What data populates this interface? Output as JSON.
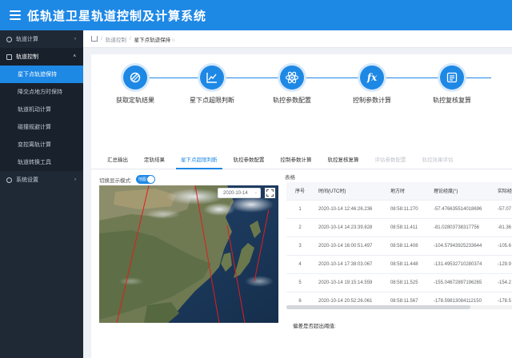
{
  "header": {
    "title": "低轨道卫星轨道控制及计算系统"
  },
  "sidebar": {
    "groups": [
      {
        "label": "轨道计算",
        "arrow": "›"
      },
      {
        "label": "轨道控制",
        "arrow": "˄"
      },
      {
        "label": "系统设置",
        "arrow": "›"
      }
    ],
    "subitems": [
      {
        "label": "星下点轨迹保持"
      },
      {
        "label": "降交点地方时保持"
      },
      {
        "label": "轨道机动计算"
      },
      {
        "label": "碰撞规避计算"
      },
      {
        "label": "变控离轨计算"
      },
      {
        "label": "轨道转换工具"
      }
    ]
  },
  "breadcrumb": {
    "parent": "轨道控制",
    "separator": "/",
    "current": "星下点轨迹保持 ◌"
  },
  "steps": [
    {
      "label": "获取定轨结果",
      "icon": "satellite-icon"
    },
    {
      "label": "星下点超限判断",
      "icon": "chart-icon"
    },
    {
      "label": "轨控参数配置",
      "icon": "atom-icon"
    },
    {
      "label": "控制参数计算",
      "icon": "fx-icon"
    },
    {
      "label": "轨控复核复算",
      "icon": "list-icon",
      "glyph": "fx"
    }
  ],
  "tabs": [
    {
      "label": "汇总输出",
      "state": "normal"
    },
    {
      "label": "定轨结果",
      "state": "normal"
    },
    {
      "label": "星下点超限判断",
      "state": "active"
    },
    {
      "label": "轨控参数配置",
      "state": "normal"
    },
    {
      "label": "控制参数计算",
      "state": "normal"
    },
    {
      "label": "轨控复核复算",
      "state": "normal"
    },
    {
      "label": "评估参数配置",
      "state": "disabled"
    },
    {
      "label": "轨控效果评估",
      "state": "disabled"
    }
  ],
  "toggle": {
    "label": "切换显示模式:",
    "value": "地图"
  },
  "map": {
    "date": "2020-10-14",
    "dropdown": "⌄"
  },
  "table": {
    "title": "表格",
    "columns": [
      "序号",
      "时间(UTC时)",
      "地方时",
      "理论经度(°)",
      "实际经"
    ],
    "rows": [
      [
        "1",
        "2020-10-14 12:46:26.236",
        "08:58:11.270",
        "-57.476635514018696",
        "-57.07"
      ],
      [
        "2",
        "2020-10-14 14:23:39.828",
        "08:58:11.411",
        "-81.02803738317756",
        "-81.36"
      ],
      [
        "3",
        "2020-10-14 16:00:51.497",
        "08:58:11.408",
        "-104.57943925233644",
        "-105.6"
      ],
      [
        "4",
        "2020-10-14 17:38:03.067",
        "08:58:11.448",
        "-131.49532710280374",
        "-129.9"
      ],
      [
        "5",
        "2020-10-14 19:15:14.559",
        "08:58:11.525",
        "-155.04672897196265",
        "-154.2"
      ],
      [
        "6",
        "2020-10-14 20:52:26.061",
        "08:58:11.567",
        "-178.59813084112150",
        "-178.5"
      ]
    ],
    "footer": "偏差是否超出阈值:"
  },
  "colors": {
    "primary": "#1e88e5",
    "sidebar": "#1f2936"
  }
}
